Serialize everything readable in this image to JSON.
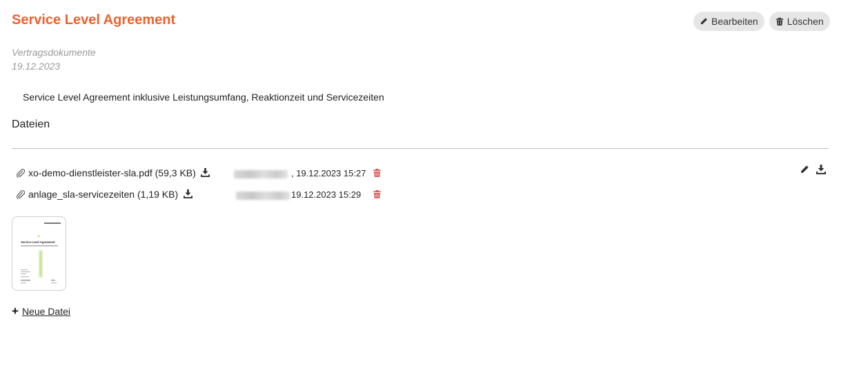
{
  "document": {
    "title": "Service Level Agreement",
    "category": "Vertragsdokumente",
    "date": "19.12.2023",
    "description": "Service Level Agreement inklusive Leistungsumfang, Reaktionzeit und Servicezeiten"
  },
  "actions": {
    "edit_label": "Bearbeiten",
    "delete_label": "Löschen"
  },
  "files": {
    "heading": "Dateien",
    "items": [
      {
        "name": "xo-demo-dienstleister-sla.pdf",
        "size": "(59,3 KB)",
        "timestamp": ", 19.12.2023 15:27"
      },
      {
        "name": "anlage_sla-servicezeiten",
        "size": "(1,19 KB)",
        "timestamp": "19.12.2023 15:29"
      }
    ],
    "new_file_label": "Neue Datei"
  },
  "thumbnail": {
    "title": "Service Level Agreement"
  },
  "colors": {
    "title": "#f0612d",
    "trash": "#e05555",
    "muted": "#9a9a9a"
  }
}
